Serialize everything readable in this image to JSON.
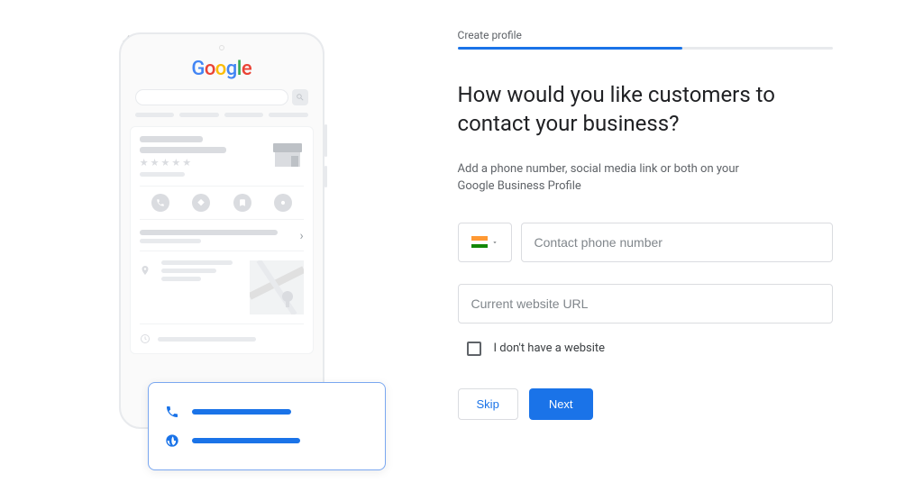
{
  "nav": {
    "back_icon": "arrow-left"
  },
  "mockup": {
    "logo_letters": [
      "G",
      "o",
      "o",
      "g",
      "l",
      "e"
    ],
    "highlight": {
      "phone_icon": "phone",
      "globe_icon": "globe"
    }
  },
  "wizard": {
    "step_label": "Create profile",
    "progress_percent": 60,
    "heading": "How would you like customers to contact your business?",
    "subtext": "Add a phone number, social media link or both on your Google Business Profile",
    "country_code": "IN",
    "phone_placeholder": "Contact phone number",
    "phone_value": "",
    "website_placeholder": "Current website URL",
    "website_value": "",
    "no_website_label": "I don't have a website",
    "no_website_checked": false,
    "skip_label": "Skip",
    "next_label": "Next"
  }
}
